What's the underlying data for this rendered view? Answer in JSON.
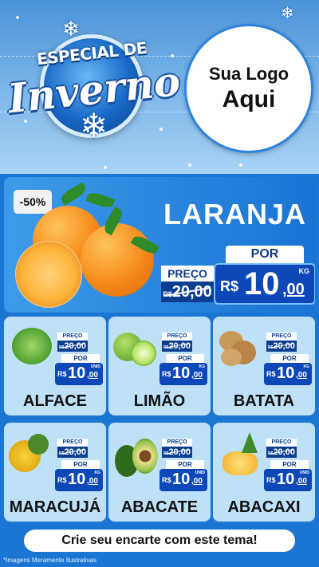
{
  "badge": {
    "line1": "ESPECIAL DE",
    "line2": "Inverno"
  },
  "logo": {
    "line1": "Sua Logo",
    "line2": "Aqui"
  },
  "hero": {
    "discount": "-50%",
    "product": "LARANJA",
    "old_label": "PREÇO",
    "old_currency": "R$",
    "old_price": "20,00",
    "new_label": "POR",
    "new_currency": "R$",
    "new_price_int": "10",
    "new_price_cents": ",00",
    "unit": "KG"
  },
  "products": [
    {
      "name": "ALFACE",
      "old_label": "PREÇO",
      "old_currency": "R$",
      "old_price": "20,00",
      "new_label": "POR",
      "currency": "R$",
      "price_int": "10",
      "price_cents": ",00",
      "unit": "UNID"
    },
    {
      "name": "LIMÃO",
      "old_label": "PREÇO",
      "old_currency": "R$",
      "old_price": "20,00",
      "new_label": "POR",
      "currency": "R$",
      "price_int": "10",
      "price_cents": ",00",
      "unit": "KG"
    },
    {
      "name": "BATATA",
      "old_label": "PREÇO",
      "old_currency": "R$",
      "old_price": "20,00",
      "new_label": "POR",
      "currency": "R$",
      "price_int": "10",
      "price_cents": ",00",
      "unit": "KG"
    },
    {
      "name": "MARACUJÁ",
      "old_label": "PREÇO",
      "old_currency": "R$",
      "old_price": "20,00",
      "new_label": "POR",
      "currency": "R$",
      "price_int": "10",
      "price_cents": ",00",
      "unit": "KG"
    },
    {
      "name": "ABACATE",
      "old_label": "PREÇO",
      "old_currency": "R$",
      "old_price": "20,00",
      "new_label": "POR",
      "currency": "R$",
      "price_int": "10",
      "price_cents": ",00",
      "unit": "UNID"
    },
    {
      "name": "ABACAXI",
      "old_label": "PREÇO",
      "old_currency": "R$",
      "old_price": "20,00",
      "new_label": "POR",
      "currency": "R$",
      "price_int": "10",
      "price_cents": ",00",
      "unit": "UNID"
    }
  ],
  "cta": "Crie seu encarte com este tema!",
  "footer": "*Imagens Meramente Ilustrativas",
  "colors": {
    "background": "#1a76d2",
    "price_box": "#0d48b8",
    "card": "#bfe1f7"
  },
  "icons": [
    "snowflake-icon",
    "orange-image",
    "lettuce-image",
    "lime-image",
    "potato-image",
    "passion-fruit-image",
    "avocado-image",
    "pineapple-image"
  ]
}
